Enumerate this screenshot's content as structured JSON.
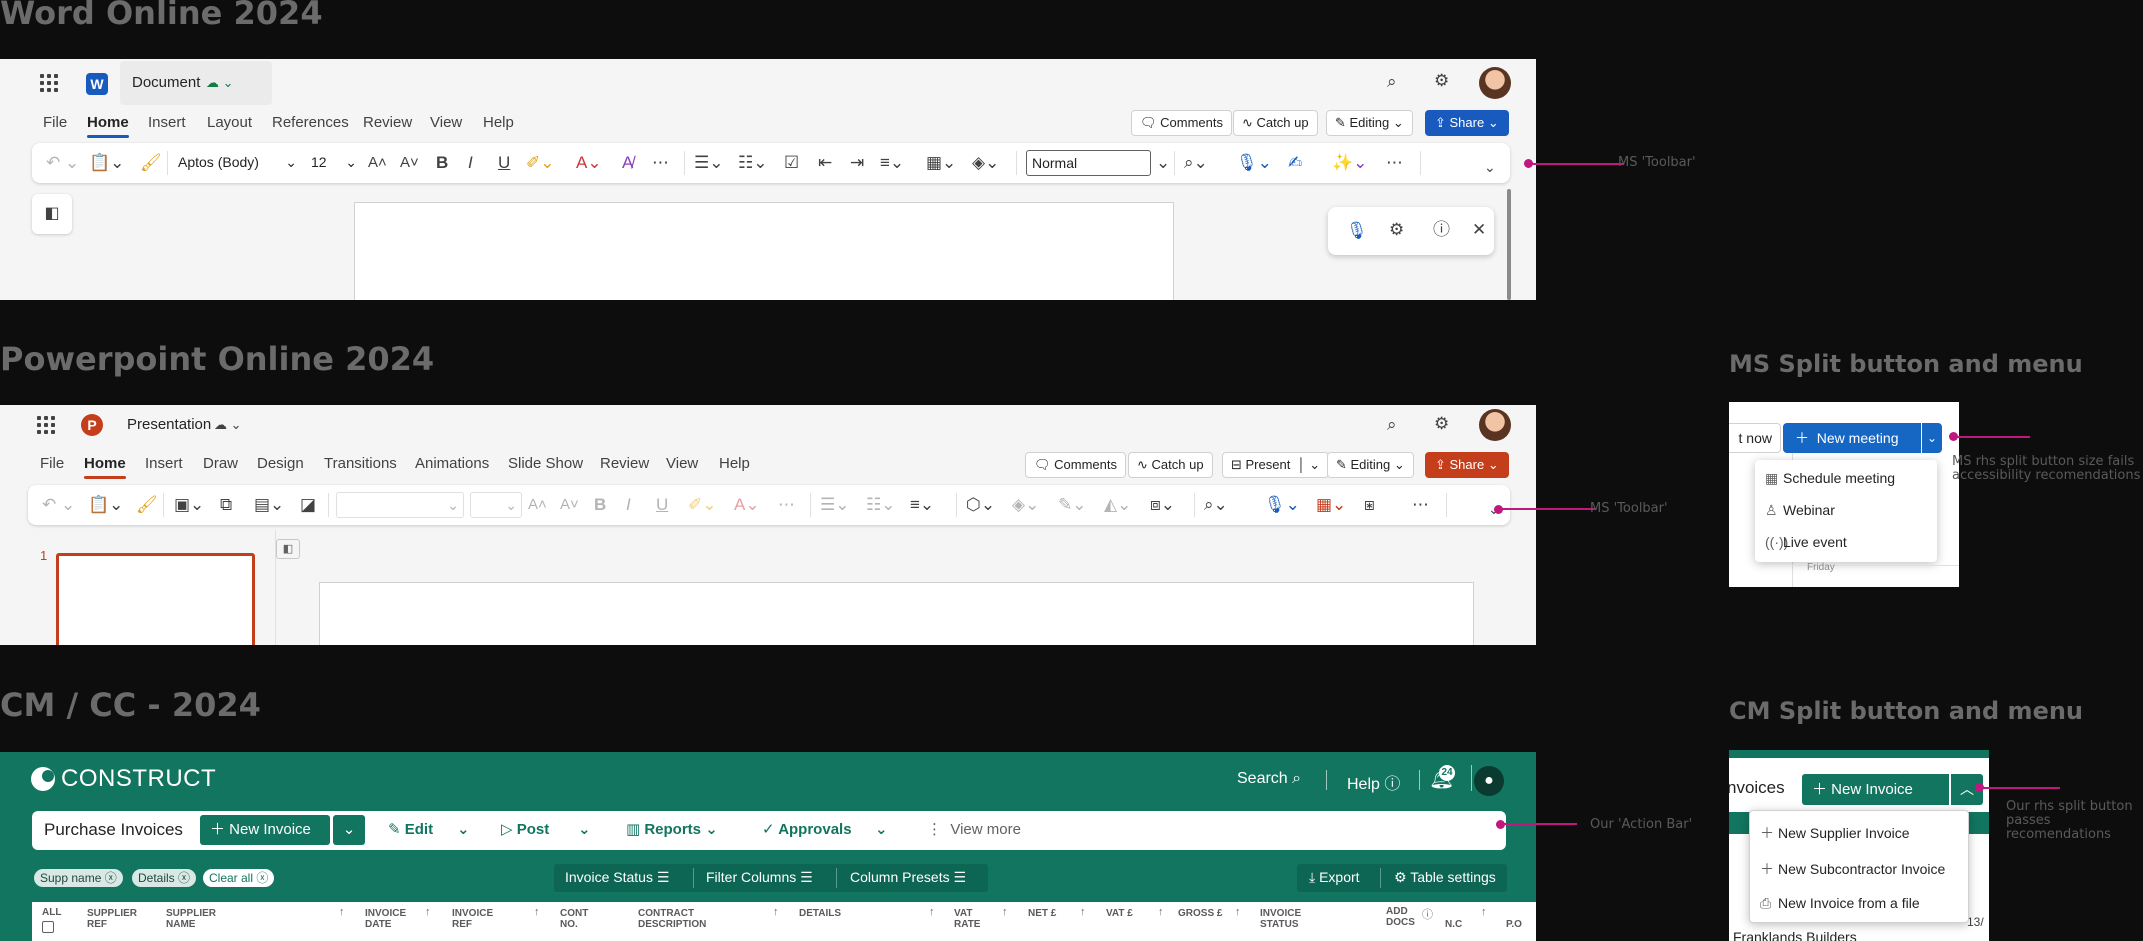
{
  "sections": {
    "word_title": "Word Online 2024",
    "ppt_title": "Powerpoint Online 2024",
    "cm_title": "CM / CC - 2024",
    "ms_split_title": "MS Split button and menu",
    "cm_split_title": "CM Split button and menu"
  },
  "annotations": {
    "word_toolbar": "MS 'Toolbar'",
    "ppt_toolbar": "MS 'Toolbar'",
    "cm_action_bar": "Our 'Action Bar'",
    "ms_split_note": "MS rhs split button size fails accessibility recomendations",
    "cm_split_note": "Our rhs split button passes recomendations"
  },
  "colors": {
    "word_brand": "#185abd",
    "ppt_brand": "#c43e1c",
    "construct_green": "#127560",
    "annotation_pink": "#c0187f"
  },
  "word": {
    "doc_name": "Document",
    "tabs": [
      "File",
      "Home",
      "Insert",
      "Layout",
      "References",
      "Review",
      "View",
      "Help"
    ],
    "buttons": {
      "comments": "Comments",
      "catchup": "Catch up",
      "editing": "Editing",
      "share": "Share"
    },
    "ribbon": {
      "font": "Aptos (Body)",
      "size": "12",
      "style": "Normal"
    }
  },
  "ppt": {
    "doc_name": "Presentation",
    "tabs": [
      "File",
      "Home",
      "Insert",
      "Draw",
      "Design",
      "Transitions",
      "Animations",
      "Slide Show",
      "Review",
      "View",
      "Help"
    ],
    "buttons": {
      "comments": "Comments",
      "catchup": "Catch up",
      "present": "Present",
      "editing": "Editing",
      "share": "Share"
    },
    "slide_number": "1"
  },
  "construct": {
    "brand": "CONSTRUCT",
    "search": "Search",
    "help": "Help",
    "notif_count": "24",
    "page_title": "Purchase Invoices",
    "new_invoice": "New Invoice",
    "actions": {
      "edit": "Edit",
      "post": "Post",
      "reports": "Reports",
      "approvals": "Approvals",
      "view_more": "View more"
    },
    "chips": [
      "Supp name",
      "Details",
      "Clear all"
    ],
    "filters": {
      "status": "Invoice Status",
      "columns": "Filter Columns",
      "presets": "Column Presets"
    },
    "export": "Export",
    "table_settings": "Table settings",
    "columns": [
      "ALL",
      "SUPPLIER REF",
      "SUPPLIER NAME",
      "INVOICE DATE",
      "INVOICE REF",
      "CONT NO.",
      "CONTRACT DESCRIPTION",
      "DETAILS",
      "VAT RATE",
      "NET £",
      "VAT £",
      "GROSS £",
      "INVOICE STATUS",
      "ADD DOCS",
      "N.C",
      "P.O"
    ]
  },
  "ms_split": {
    "prev_button": "t now",
    "new_meeting": "New meeting",
    "items": [
      "Schedule meeting",
      "Webinar",
      "Live event"
    ],
    "day": "Friday"
  },
  "cm_split": {
    "heading": "nvoices",
    "new_invoice": "New Invoice",
    "items": [
      "New Supplier Invoice",
      "New Subcontractor Invoice",
      "New Invoice from a file"
    ],
    "row_text": "Franklands Builders",
    "row_suffix": "13/"
  }
}
